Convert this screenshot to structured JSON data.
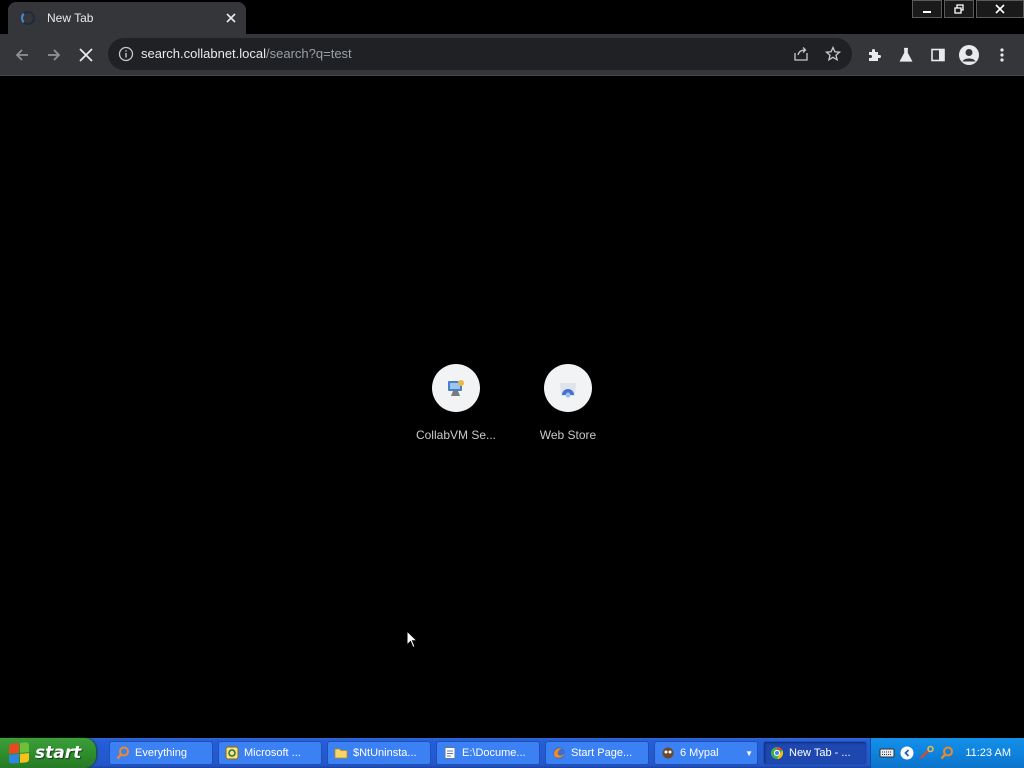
{
  "browser": {
    "tab": {
      "title": "New Tab"
    },
    "address": {
      "host": "search.collabnet.local",
      "path": "/search?q=test"
    }
  },
  "shortcuts": [
    {
      "label": "CollabVM Se...",
      "icon": "collabvm-icon"
    },
    {
      "label": "Web Store",
      "icon": "web-store-icon"
    }
  ],
  "taskbar": {
    "start_label": "start",
    "tasks": [
      {
        "label": "Everything",
        "icon": "magnifier-icon"
      },
      {
        "label": "Microsoft ...",
        "icon": "ie-window-icon"
      },
      {
        "label": "$NtUninsta...",
        "icon": "folder-icon"
      },
      {
        "label": "E:\\Docume...",
        "icon": "notepad-icon"
      },
      {
        "label": "Start Page...",
        "icon": "firefox-icon"
      },
      {
        "label": "6 Mypal",
        "icon": "mypal-icon"
      },
      {
        "label": "New Tab - ...",
        "icon": "chrome-icon"
      }
    ],
    "clock": "11:23 AM"
  },
  "colors": {
    "chrome_toolbar": "#35363a",
    "omnibox": "#202124",
    "taskbar_blue": "#245edb",
    "start_green": "#2e8f2c",
    "tray_blue": "#0f83de"
  }
}
